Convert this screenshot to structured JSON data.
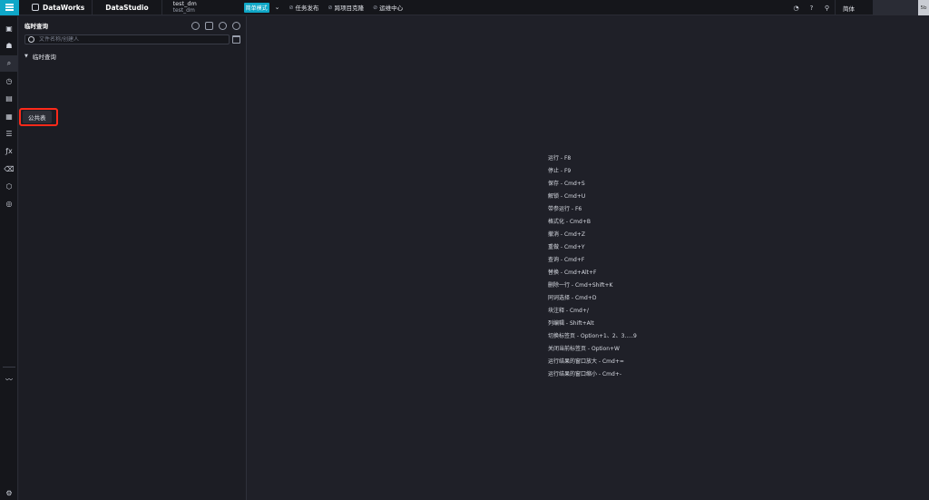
{
  "topbar": {
    "brand": "DataWorks",
    "studio": "DataStudio",
    "project_name": "test_dm",
    "project_sub": "test_dm",
    "mode": "简单模式",
    "links": [
      {
        "label": "任务发布"
      },
      {
        "label": "跨项目克隆"
      },
      {
        "label": "运维中心"
      }
    ],
    "lang": "简体",
    "user_suffix": "5b"
  },
  "rail": {
    "tooltip": "公共表"
  },
  "panel": {
    "title": "临时查询",
    "search_placeholder": "文件名称/创建人",
    "tree": [
      {
        "label": "临时查询"
      }
    ]
  },
  "editor": {
    "shortcuts": [
      "运行 - F8",
      "停止 - F9",
      "保存 - Cmd+S",
      "解锁 - Cmd+U",
      "带参运行 - F6",
      "格式化 - Cmd+B",
      "撤消 - Cmd+Z",
      "重做 - Cmd+Y",
      "查询 - Cmd+F",
      "替换 - Cmd+Alt+F",
      "删除一行 - Cmd+Shift+K",
      "同词选择 - Cmd+D",
      "块注释 - Cmd+/",
      "列编辑 - Shift+Alt",
      "切换标签页 - Option+1、2、3.....9",
      "关闭当前标签页 - Option+W",
      "运行结果的窗口放大 - Cmd+=",
      "运行结果的窗口缩小 - Cmd+-"
    ]
  }
}
